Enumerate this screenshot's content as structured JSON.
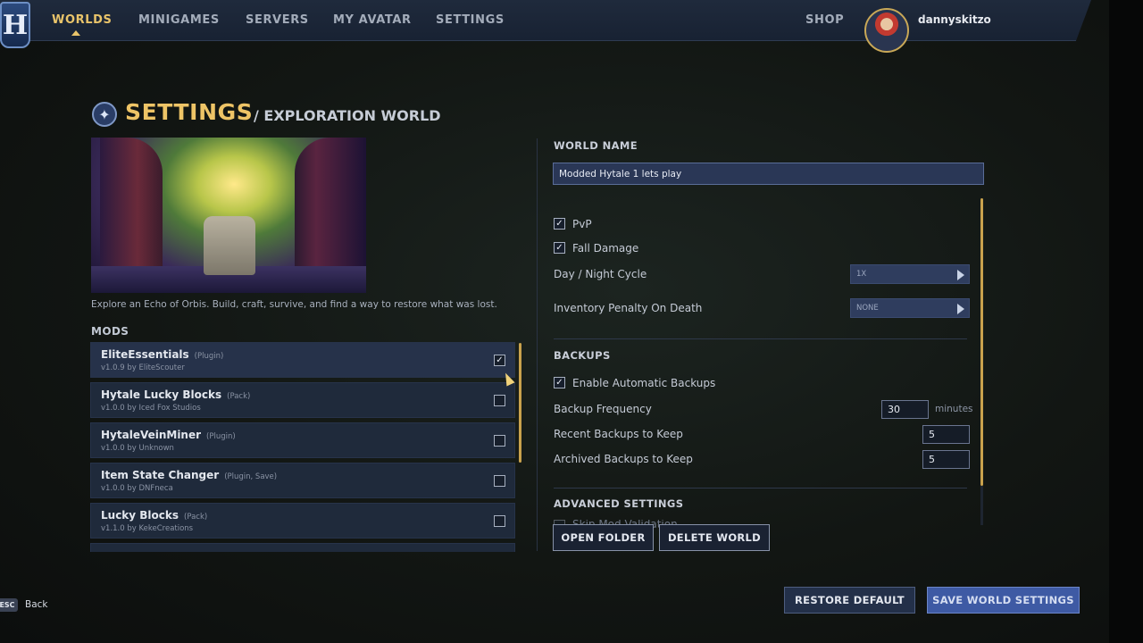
{
  "nav": {
    "logo_letter": "H",
    "items": [
      {
        "label": "WORLDS",
        "active": true
      },
      {
        "label": "MINIGAMES",
        "active": false
      },
      {
        "label": "SERVERS",
        "active": false
      },
      {
        "label": "MY AVATAR",
        "active": false
      },
      {
        "label": "SETTINGS",
        "active": false
      }
    ],
    "shop": "SHOP",
    "username": "dannyskitzo"
  },
  "header": {
    "title": "SETTINGS",
    "subtitle": "/ EXPLORATION WORLD"
  },
  "world": {
    "description": "Explore an Echo of Orbis. Build, craft, survive, and find a way to restore what was lost."
  },
  "mods": {
    "label": "MODS",
    "items": [
      {
        "name": "EliteEssentials",
        "type": "(Plugin)",
        "meta": "v1.0.9 by EliteScouter",
        "checked": true
      },
      {
        "name": "Hytale Lucky Blocks",
        "type": "(Pack)",
        "meta": "v1.0.0 by Iced Fox Studios",
        "checked": false
      },
      {
        "name": "HytaleVeinMiner",
        "type": "(Plugin)",
        "meta": "v1.0.0 by Unknown",
        "checked": false
      },
      {
        "name": "Item State Changer",
        "type": "(Plugin, Save)",
        "meta": "v1.0.0 by DNFneca",
        "checked": false
      },
      {
        "name": "Lucky Blocks",
        "type": "(Pack)",
        "meta": "v1.1.0 by KekeCreations",
        "checked": false
      }
    ]
  },
  "settings": {
    "world_name_label": "WORLD NAME",
    "world_name_value": "Modded Hytale 1 lets play",
    "pvp": {
      "label": "PvP",
      "checked": true
    },
    "fall_damage": {
      "label": "Fall Damage",
      "checked": true
    },
    "day_night": {
      "label": "Day / Night Cycle",
      "value": "1X"
    },
    "inventory_penalty": {
      "label": "Inventory Penalty On Death",
      "value": "NONE"
    },
    "backups_label": "BACKUPS",
    "auto_backups": {
      "label": "Enable Automatic Backups",
      "checked": true
    },
    "backup_frequency": {
      "label": "Backup Frequency",
      "value": "30",
      "unit": "minutes"
    },
    "recent_backups": {
      "label": "Recent Backups to Keep",
      "value": "5"
    },
    "archived_backups": {
      "label": "Archived Backups to Keep",
      "value": "5"
    },
    "advanced_label": "ADVANCED SETTINGS",
    "skip_mod_validation": "Skip Mod Validation"
  },
  "actions": {
    "open_folder": "OPEN FOLDER",
    "delete_world": "DELETE WORLD",
    "restore_default": "RESTORE DEFAULT",
    "save": "SAVE WORLD SETTINGS"
  },
  "footer": {
    "esc": "ESC",
    "back": "Back"
  },
  "colors": {
    "accent_gold": "#e9c46a",
    "primary_button": "#3e5aa4",
    "panel": "#1f2a3b"
  }
}
